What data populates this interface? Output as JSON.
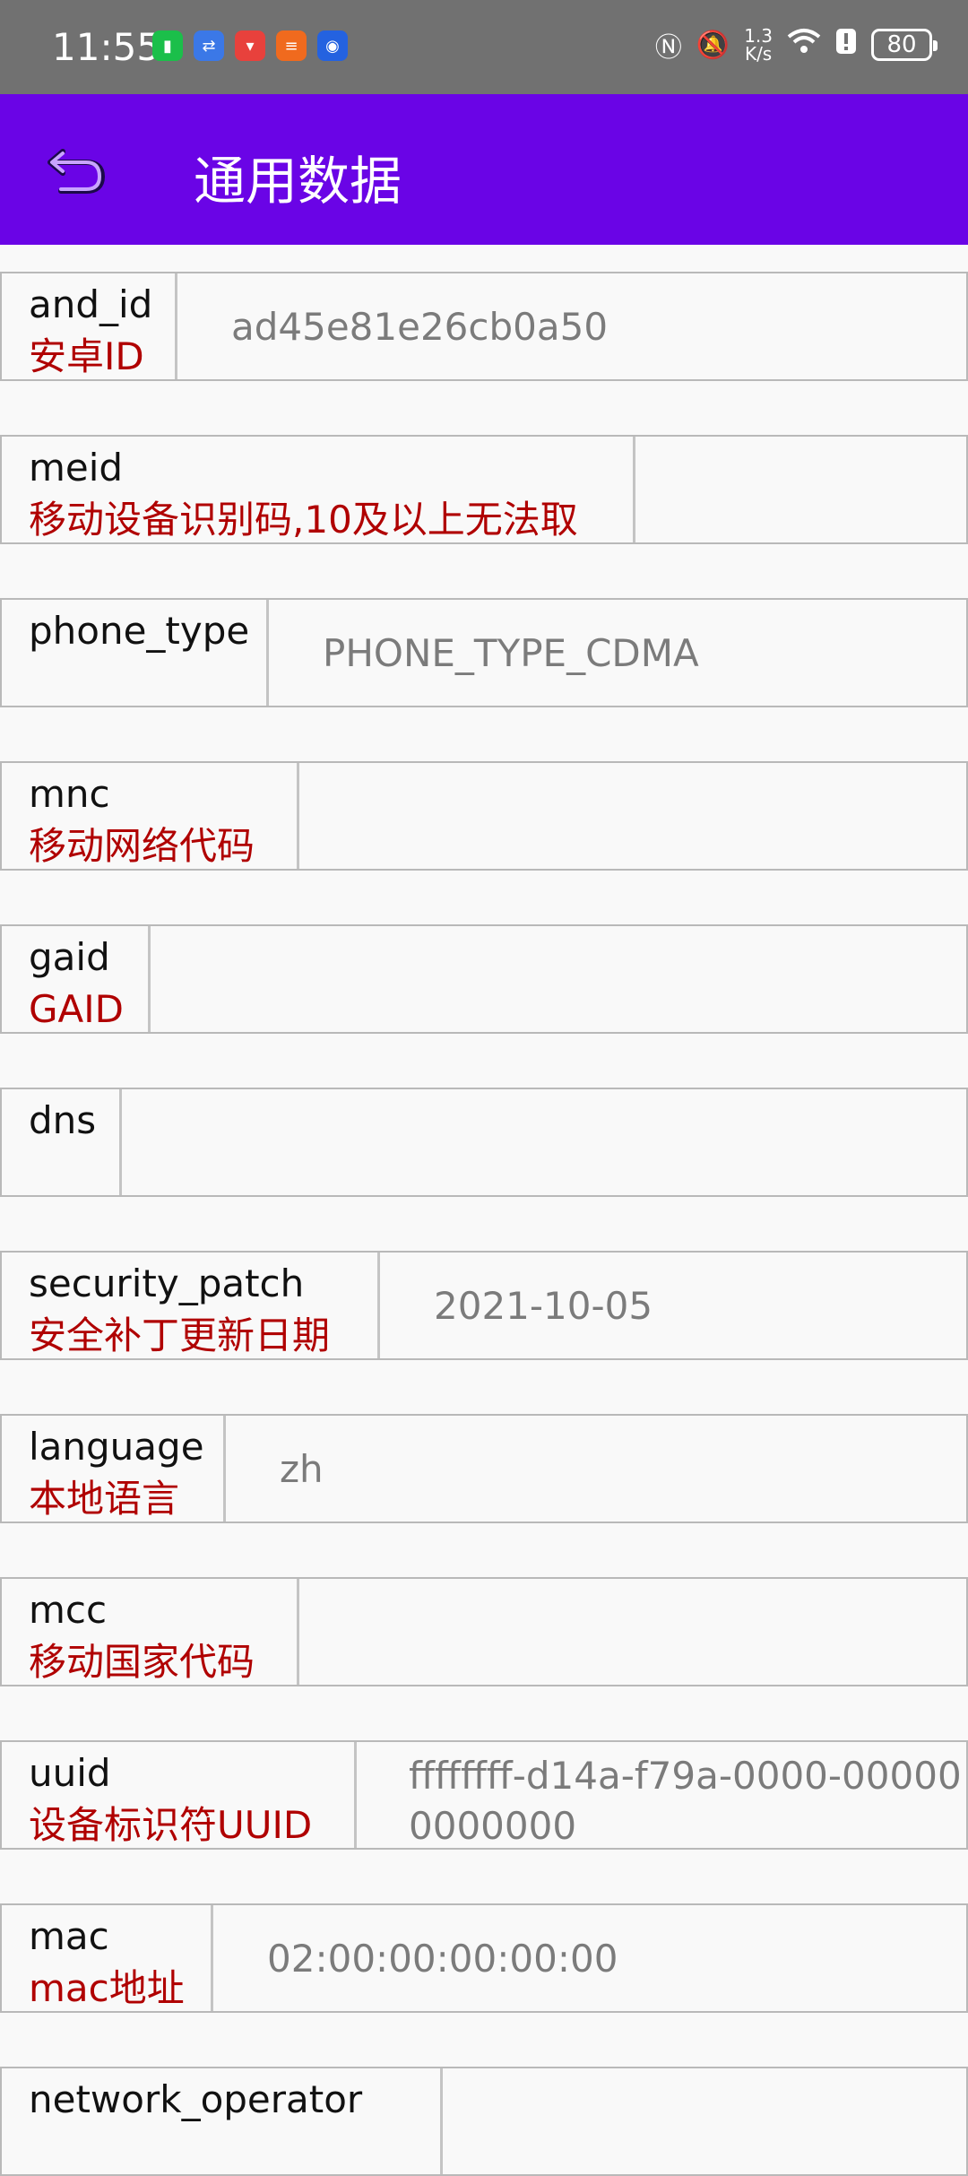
{
  "status_bar": {
    "time": "11:55",
    "net_speed_top": "1.3",
    "net_speed_bottom": "K/s",
    "battery": "80"
  },
  "app_bar": {
    "title": "通用数据"
  },
  "rows": [
    {
      "key": "and_id",
      "desc": "安卓ID",
      "value": "ad45e81e26cb0a50"
    },
    {
      "key": "meid",
      "desc": "移动设备识别码,10及以上无法取",
      "value": ""
    },
    {
      "key": "phone_type",
      "desc": "",
      "value": "PHONE_TYPE_CDMA"
    },
    {
      "key": "mnc",
      "desc": "移动网络代码",
      "value": ""
    },
    {
      "key": "gaid",
      "desc": "GAID",
      "value": ""
    },
    {
      "key": "dns",
      "desc": "",
      "value": ""
    },
    {
      "key": "security_patch",
      "desc": "安全补丁更新日期",
      "value": "2021-10-05"
    },
    {
      "key": "language",
      "desc": "本地语言",
      "value": "zh"
    },
    {
      "key": "mcc",
      "desc": "移动国家代码",
      "value": ""
    },
    {
      "key": "uuid",
      "desc": "设备标识符UUID",
      "value_line1": "ffffffff-d14a-f79a-0000-00000",
      "value_line2": "0000000"
    },
    {
      "key": "mac",
      "desc": "mac地址",
      "value": "02:00:00:00:00:00"
    },
    {
      "key": "network_operator",
      "desc": "",
      "value": ""
    }
  ]
}
